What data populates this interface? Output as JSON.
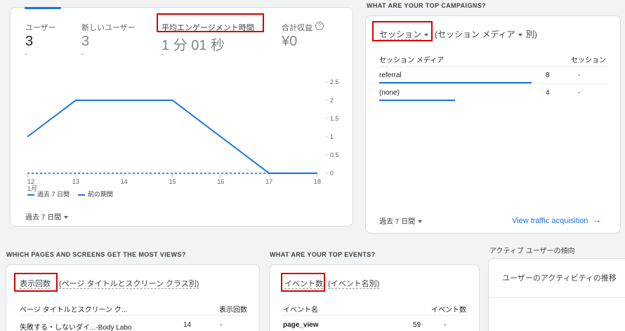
{
  "overview": {
    "metrics": [
      {
        "label": "ユーザー",
        "value": "3",
        "delta": "-"
      },
      {
        "label": "新しいユーザー",
        "value": "3",
        "delta": "-"
      },
      {
        "label": "平均エンゲージメント時間",
        "value": "1 分 01 秒",
        "delta": "-"
      },
      {
        "label": "合計収益",
        "value": "¥0",
        "delta": ""
      }
    ],
    "help_icon": "help-circle-icon",
    "legend": {
      "current": "過去 7 日間",
      "previous": "前の期間"
    },
    "date_range": "過去 7 日間",
    "x_month": "1月"
  },
  "chart_data": {
    "type": "line",
    "x": [
      "12",
      "13",
      "14",
      "15",
      "16",
      "17",
      "18"
    ],
    "series": [
      {
        "name": "過去 7 日間",
        "values": [
          1,
          2,
          2,
          2,
          1,
          0,
          0
        ]
      },
      {
        "name": "前の期間",
        "values": [
          0,
          0,
          0,
          0,
          0,
          0,
          0
        ]
      }
    ],
    "yticks": [
      "2.5",
      "2",
      "1.5",
      "1",
      "0.5",
      "0"
    ],
    "ylim": [
      0,
      2.5
    ],
    "title": "",
    "xlabel": "",
    "ylabel": "",
    "colors": {
      "current": "#1a73e8",
      "previous": "#1a73e8"
    }
  },
  "campaigns": {
    "title": "WHAT ARE YOUR TOP CAMPAIGNS?",
    "metric_selector": "セッション",
    "dimension_selector": "(セッション メディア",
    "dimension_suffix": "別)",
    "col_dimension": "セッション メディア",
    "col_metric": "セッション",
    "rows": [
      {
        "label": "referral",
        "value": "8",
        "delta": "-"
      },
      {
        "label": "(none)",
        "value": "4",
        "delta": "-"
      }
    ],
    "date_range": "過去 7 日間",
    "link": "View traffic acquisition"
  },
  "pages": {
    "title": "WHICH PAGES AND SCREENS GET THE MOST VIEWS?",
    "metric_selector": "表示回数",
    "dimension_selector": "(ページ タイトルとスクリーン クラス別)",
    "col_dimension": "ページ タイトルとスクリーン ク...",
    "col_metric": "表示回数",
    "rows": [
      {
        "label": "失敗する・しないダイ...-Body Labo",
        "value": "14",
        "delta": "-"
      }
    ]
  },
  "events": {
    "title": "WHAT ARE YOUR TOP EVENTS?",
    "metric_selector": "イベント数",
    "dimension_selector": "(イベント名別)",
    "col_dimension": "イベント名",
    "col_metric": "イベント数",
    "rows": [
      {
        "label": "page_view",
        "value": "59",
        "delta": "-"
      }
    ]
  },
  "trend": {
    "title": "アクティブ ユーザーの傾向",
    "card_title": "ユーザーのアクティビティの推移"
  }
}
